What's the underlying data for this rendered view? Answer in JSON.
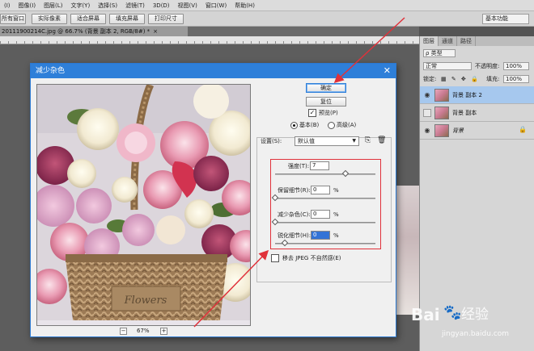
{
  "menu": [
    "(I)",
    "图像(I)",
    "图层(L)",
    "文字(Y)",
    "选择(S)",
    "滤镜(T)",
    "3D(D)",
    "视图(V)",
    "窗口(W)",
    "帮助(H)"
  ],
  "options": {
    "buttons": [
      "所有窗口",
      "实际像素",
      "适合屏幕",
      "填充屏幕",
      "打印尺寸"
    ],
    "workspace": "基本功能"
  },
  "document_tab": {
    "title": "20111900214C.jpg @ 66.7% (背景 副本 2, RGB/8#) *",
    "close": "×"
  },
  "panels": {
    "tabs": [
      "图层",
      "通道",
      "路径"
    ],
    "kind_filter": "ρ 类型",
    "blend_mode": "正常",
    "opacity_label": "不透明度:",
    "opacity_value": "100%",
    "lock_label": "锁定:",
    "fill_label": "填充:",
    "fill_value": "100%",
    "layers": [
      {
        "name": "背景 副本 2",
        "selected": true,
        "visible": true,
        "locked": false
      },
      {
        "name": "背景 副本",
        "selected": false,
        "visible": false,
        "locked": false
      },
      {
        "name": "背景",
        "selected": false,
        "visible": true,
        "locked": true
      }
    ]
  },
  "dialog": {
    "title": "减少杂色",
    "close": "✕",
    "ok": "确定",
    "reset": "复位",
    "preview_label": "预览(P)",
    "preview_checked": true,
    "mode_basic": "基本(B)",
    "mode_advanced": "高级(A)",
    "mode_selected": "basic",
    "settings_label": "设置(S):",
    "settings_value": "默认值",
    "zoom": "67%",
    "zoom_out": "−",
    "zoom_in": "+",
    "sliders": [
      {
        "label": "强度(T):",
        "value": "7",
        "unit": "",
        "level": 0.7
      },
      {
        "label": "保留细节(R):",
        "value": "0",
        "unit": "%",
        "level": 0.0
      },
      {
        "label": "减少杂色(C):",
        "value": "0",
        "unit": "%",
        "level": 0.0
      },
      {
        "label": "锐化细节(H):",
        "value": "0",
        "unit": "%",
        "level": 0.1
      }
    ],
    "jpeg_label": "移去 JPEG 不自然感(E)",
    "jpeg_checked": false,
    "basket_text": "Flowers"
  },
  "watermark": {
    "brand": "Bai",
    "brand2": "经验",
    "url": "jingyan.baidu.com"
  },
  "colors": {
    "title_blue": "#2e7fd9",
    "highlight_red": "#e0313a"
  }
}
